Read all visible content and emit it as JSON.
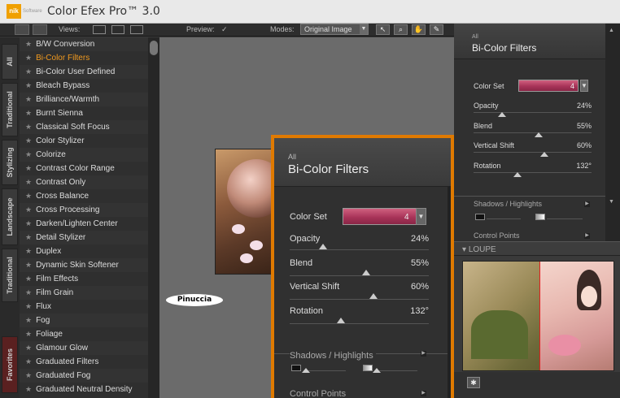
{
  "titlebar": {
    "logo_nik": "nik",
    "logo_soft": "Software",
    "app_title": "Color Efex Pro™ 3.0"
  },
  "toolbar": {
    "views_label": "Views:",
    "preview_label": "Preview:",
    "preview_check": "✓",
    "modes_label": "Modes:",
    "mode_value": "Original Image"
  },
  "side_tabs": [
    "All",
    "Traditional",
    "Stylizing",
    "Landscape",
    "Traditional",
    "Favorites"
  ],
  "filters": [
    "B/W Conversion",
    "Bi-Color Filters",
    "Bi-Color User Defined",
    "Bleach Bypass",
    "Brilliance/Warmth",
    "Burnt Sienna",
    "Classical Soft Focus",
    "Color Stylizer",
    "Colorize",
    "Contrast Color Range",
    "Contrast Only",
    "Cross Balance",
    "Cross Processing",
    "Darken/Lighten Center",
    "Detail Stylizer",
    "Duplex",
    "Dynamic Skin Softener",
    "Film Effects",
    "Film Grain",
    "Flux",
    "Fog",
    "Foliage",
    "Glamour Glow",
    "Graduated Filters",
    "Graduated Fog",
    "Graduated Neutral Density"
  ],
  "active_filter_index": 1,
  "watermark": "Pinuccia",
  "panel": {
    "crumb": "All",
    "title": "Bi-Color Filters",
    "color_set_label": "Color Set",
    "color_set_value": "4",
    "params": [
      {
        "label": "Opacity",
        "value": "24%",
        "level": 0.24
      },
      {
        "label": "Blend",
        "value": "55%",
        "level": 0.55
      },
      {
        "label": "Vertical Shift",
        "value": "60%",
        "level": 0.6
      },
      {
        "label": "Rotation",
        "value": "132°",
        "level": 0.37
      }
    ],
    "shadows_label": "Shadows / Highlights",
    "control_points_label": "Control Points"
  },
  "loupe": {
    "label": "LOUPE"
  },
  "colors": {
    "accent_orange": "#e07a00",
    "active_text": "#f29a1f",
    "swatch_pink": "#a83459"
  }
}
